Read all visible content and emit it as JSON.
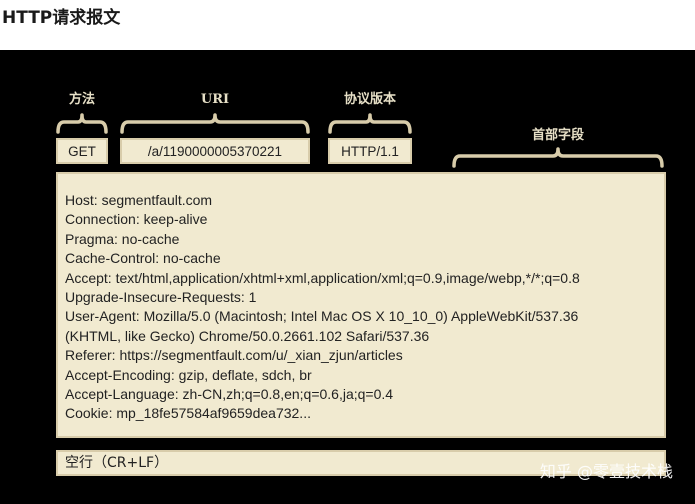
{
  "page_title": "HTTP请求报文",
  "request_line": {
    "method_label": "方法",
    "uri_label": "URI",
    "version_label": "协议版本",
    "method": "GET",
    "uri": "/a/1190000005370221",
    "version": "HTTP/1.1"
  },
  "headers_label": "首部字段",
  "headers": [
    "Host: segmentfault.com",
    "Connection: keep-alive",
    "Pragma: no-cache",
    "Cache-Control: no-cache",
    "Accept: text/html,application/xhtml+xml,application/xml;q=0.9,image/webp,*/*;q=0.8",
    "Upgrade-Insecure-Requests: 1",
    "User-Agent: Mozilla/5.0 (Macintosh; Intel Mac OS X 10_10_0) AppleWebKit/537.36",
    "(KHTML, like Gecko) Chrome/50.0.2661.102 Safari/537.36",
    "Referer: https://segmentfault.com/u/_xian_zjun/articles",
    "Accept-Encoding: gzip, deflate, sdch, br",
    "Accept-Language: zh-CN,zh;q=0.8,en;q=0.6,ja;q=0.4",
    "Cookie: mp_18fe57584af9659dea732..."
  ],
  "empty_line": "空行（CR+LF）",
  "watermark": "知乎 @零壹技术栈",
  "colors": {
    "background": "#000000",
    "box_fill": "#f1ead0",
    "bracket": "#d8ccaa",
    "label_text": "#e6dfc6"
  }
}
